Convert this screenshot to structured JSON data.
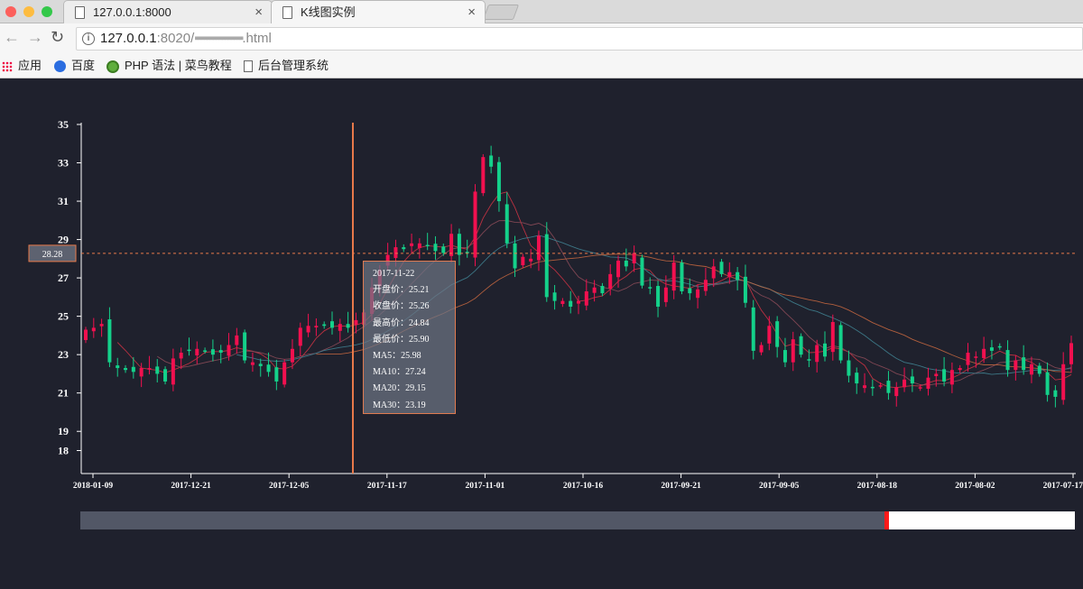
{
  "browser": {
    "tabs": [
      {
        "title": "127.0.0.1:8000",
        "close": "×"
      },
      {
        "title": "K线图实例",
        "close": "×"
      }
    ],
    "url_host": "127.0.0.1",
    "url_rest": ":8020/",
    "url_obscured": "▪▪▪▪▪▪▪▪▪▪▪▪▪▪▪▪",
    "url_ext": ".html",
    "nav": {
      "back": "←",
      "forward": "→",
      "reload": "↻",
      "info": "i"
    },
    "bookmarks": [
      {
        "label": "应用",
        "icon": "apps-icon"
      },
      {
        "label": "百度",
        "icon": "baidu-paw-icon"
      },
      {
        "label": "PHP 语法 | 菜鸟教程",
        "icon": "runoob-icon"
      },
      {
        "label": "后台管理系统",
        "icon": "page-icon"
      }
    ]
  },
  "chart_data": {
    "type": "candlestick",
    "title": "",
    "y_ticks": [
      35,
      33,
      31,
      29,
      27,
      25,
      23,
      21,
      19,
      18
    ],
    "ylim": [
      16.8,
      35
    ],
    "x_ticks": [
      "2018-01-09",
      "2017-12-21",
      "2017-12-05",
      "2017-11-17",
      "2017-11-01",
      "2017-10-16",
      "2017-09-21",
      "2017-09-05",
      "2017-08-18",
      "2017-08-02",
      "2017-07-17"
    ],
    "crosshair": {
      "value_label": "28.28",
      "y_value": 28.28,
      "date": "2017-11-22"
    },
    "tooltip": {
      "date": "2017-11-22",
      "rows": [
        {
          "label": "开盘价：",
          "value": "25.21"
        },
        {
          "label": "收盘价：",
          "value": "25.26"
        },
        {
          "label": "最高价：",
          "value": "24.84"
        },
        {
          "label": "最低价：",
          "value": "25.90"
        },
        {
          "label": "MA5：",
          "value": "25.98"
        },
        {
          "label": "MA10：",
          "value": "27.24"
        },
        {
          "label": "MA20：",
          "value": "29.15"
        },
        {
          "label": "MA30：",
          "value": "23.19"
        }
      ]
    },
    "colors": {
      "up": "#f2104f",
      "down": "#14d18a",
      "ma5": "#cc3344",
      "ma10": "#8a4a58",
      "ma20": "#3f7f8f",
      "ma30": "#c0653f",
      "crosshair": "#e8794a",
      "axis": "#ffffff"
    },
    "closes": [
      24.3,
      24.4,
      24.6,
      22.6,
      22.3,
      22.2,
      22.1,
      22.3,
      22.3,
      22.0,
      21.6,
      22.8,
      23.1,
      23.2,
      23.3,
      23.2,
      23.0,
      23.1,
      23.5,
      24.0,
      22.7,
      22.6,
      22.4,
      22.1,
      21.6,
      22.6,
      23.3,
      24.4,
      24.5,
      24.5,
      24.5,
      24.4,
      24.6,
      24.4,
      24.8,
      25.2,
      26.5,
      27.4,
      28.2,
      28.6,
      28.5,
      28.8,
      28.8,
      28.7,
      28.4,
      28.3,
      29.3,
      28.2,
      28.3,
      31.5,
      33.3,
      32.8,
      31.0,
      28.8,
      27.5,
      28.1,
      28.0,
      29.2,
      26.0,
      25.8,
      25.8,
      25.5,
      25.8,
      26.3,
      26.5,
      26.2,
      27.2,
      27.9,
      27.6,
      28.3,
      26.6,
      26.5,
      25.5,
      26.5,
      27.8,
      26.3,
      26.2,
      26.4,
      26.9,
      27.6,
      27.2,
      27.3,
      26.9,
      25.7,
      23.2,
      23.5,
      24.5,
      23.4,
      22.6,
      23.8,
      23.0,
      22.7,
      23.5,
      22.9,
      24.7,
      22.7,
      21.9,
      21.5,
      21.4,
      21.3,
      21.4,
      21.0,
      21.3,
      21.7,
      21.5,
      21.3,
      21.8,
      22.0,
      21.6,
      22.2,
      22.3,
      23.1,
      22.9,
      23.3,
      23.2,
      23.4,
      22.2,
      22.7,
      22.2,
      22.5,
      22.0,
      20.9,
      20.8,
      22.5,
      23.6
    ]
  }
}
